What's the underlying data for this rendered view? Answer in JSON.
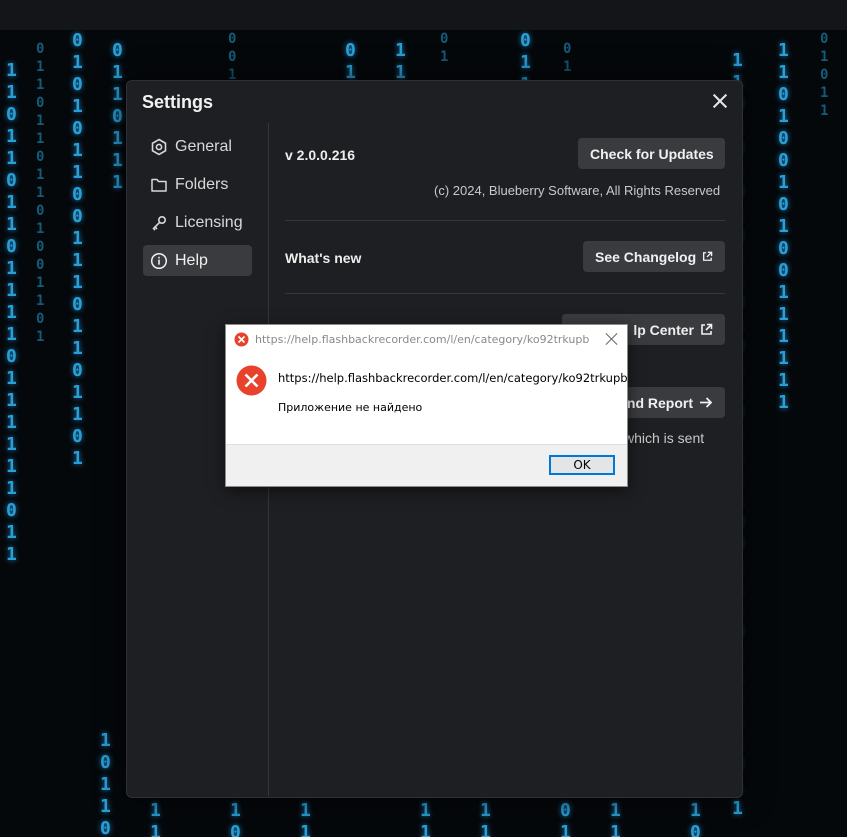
{
  "settings": {
    "title": "Settings",
    "nav": [
      {
        "label": "General",
        "icon": "gear-icon"
      },
      {
        "label": "Folders",
        "icon": "folder-icon"
      },
      {
        "label": "Licensing",
        "icon": "key-icon"
      },
      {
        "label": "Help",
        "icon": "info-icon",
        "active": true
      }
    ],
    "version": "v 2.0.0.216",
    "check_updates": "Check for Updates",
    "copyright": "(c) 2024, Blueberry Software, All Rights Reserved",
    "whats_new": "What's new",
    "see_changelog": "See Changelog",
    "help_center_partial": "lp Center",
    "send_report_partial": "nd Report",
    "sent_text_partial": "which is sent"
  },
  "dialog": {
    "title": "https://help.flashbackrecorder.com/l/en/category/ko92trkupb",
    "url": "https://help.flashbackrecorder.com/l/en/category/ko92trkupb",
    "message": "Приложение не найдено",
    "ok": "OK"
  },
  "colors": {
    "panel_bg": "#1e1f22",
    "button_bg": "#3a3b3f",
    "matrix": "#2a9fd6",
    "error_red": "#e8412c",
    "ok_border": "#0078d7"
  }
}
